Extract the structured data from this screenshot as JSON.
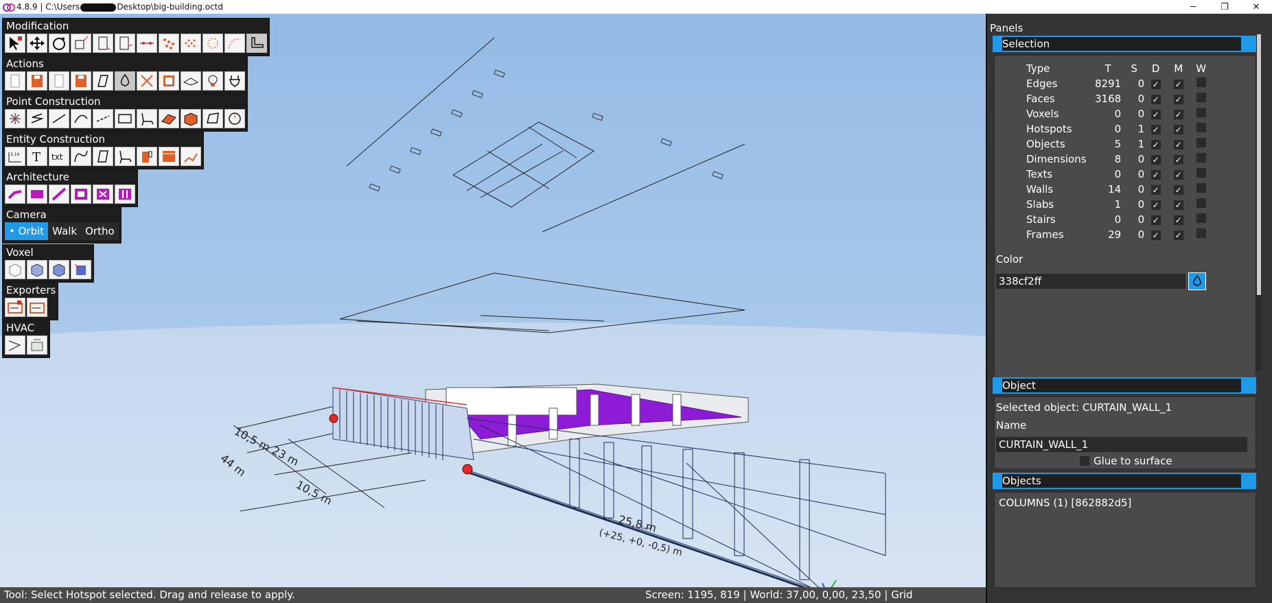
{
  "titlebar": {
    "version": "4.8.9",
    "path_prefix": "| C:\\Users",
    "path_suffix": "Desktop\\big-building.octd",
    "minimize": "─",
    "maximize": "❐",
    "close": "✕"
  },
  "toolbars": {
    "modification": "Modification",
    "actions": "Actions",
    "point_construction": "Point Construction",
    "entity_construction": "Entity Construction",
    "architecture": "Architecture",
    "camera": "Camera",
    "voxel": "Voxel",
    "exporters": "Exporters",
    "hvac": "HVAC",
    "entity_labels": {
      "dim_value": "3.14",
      "text_tool": "T",
      "txt_tool": "txt"
    }
  },
  "camera": {
    "orbit": "• Orbit",
    "walk": "Walk",
    "ortho": "Ortho"
  },
  "viewport": {
    "dims": [
      "10,5 m",
      "23 m",
      "44 m",
      "10,5 m",
      "25,8 m",
      "(+25, +0, -0,5) m"
    ]
  },
  "status": {
    "tool": "Tool: Select Hotspot selected. Drag and release to apply.",
    "coords": "Screen: 1195, 819 | World: 37,00, 0,00, 23,50 | Grid"
  },
  "panels": {
    "title": "Panels",
    "selection": {
      "header": "Selection",
      "columns": {
        "type": "Type",
        "t": "T",
        "s": "S",
        "d": "D",
        "m": "M",
        "w": "W"
      },
      "rows": [
        {
          "type": "Edges",
          "t": "8291",
          "s": "0",
          "d": true,
          "m": true,
          "w": false
        },
        {
          "type": "Faces",
          "t": "3168",
          "s": "0",
          "d": true,
          "m": true,
          "w": false
        },
        {
          "type": "Voxels",
          "t": "0",
          "s": "0",
          "d": true,
          "m": true,
          "w": false
        },
        {
          "type": "Hotspots",
          "t": "0",
          "s": "1",
          "d": true,
          "m": true,
          "w": false
        },
        {
          "type": "Objects",
          "t": "5",
          "s": "1",
          "d": true,
          "m": true,
          "w": false
        },
        {
          "type": "Dimensions",
          "t": "8",
          "s": "0",
          "d": true,
          "m": true,
          "w": false
        },
        {
          "type": "Texts",
          "t": "0",
          "s": "0",
          "d": true,
          "m": true,
          "w": false
        },
        {
          "type": "Walls",
          "t": "14",
          "s": "0",
          "d": true,
          "m": true,
          "w": false
        },
        {
          "type": "Slabs",
          "t": "1",
          "s": "0",
          "d": true,
          "m": true,
          "w": false
        },
        {
          "type": "Stairs",
          "t": "0",
          "s": "0",
          "d": true,
          "m": true,
          "w": false
        },
        {
          "type": "Frames",
          "t": "29",
          "s": "0",
          "d": true,
          "m": true,
          "w": false
        }
      ],
      "color_label": "Color",
      "color_value": "338cf2ff"
    },
    "object": {
      "header": "Object",
      "selected": "Selected object: CURTAIN_WALL_1",
      "name_label": "Name",
      "name_value": "CURTAIN_WALL_1",
      "glue": "Glue to surface"
    },
    "objects": {
      "header": "Objects",
      "first_item": "COLUMNS (1) [862882d5]"
    }
  },
  "colors": {
    "accent": "#1e9ae8",
    "slab": "#8a1ed8",
    "panel_bg": "#343434"
  }
}
